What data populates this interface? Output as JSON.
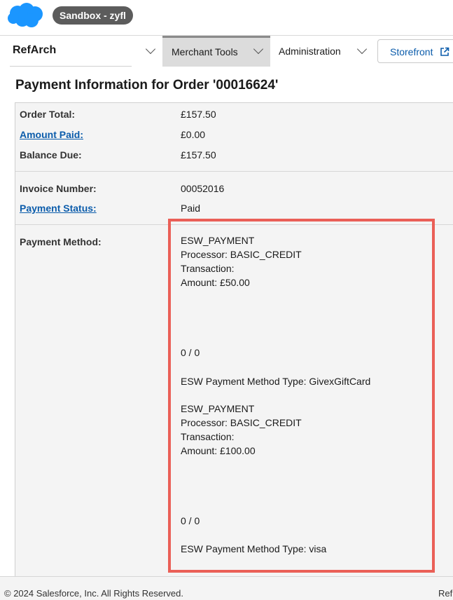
{
  "header": {
    "sandbox_label": "Sandbox - zyfl"
  },
  "nav": {
    "site": "RefArch",
    "merchant_tools": "Merchant Tools",
    "administration": "Administration",
    "storefront": "Storefront"
  },
  "page": {
    "title": "Payment Information for Order '00016624'"
  },
  "summary": {
    "order_total_label": "Order Total:",
    "order_total": "£157.50",
    "amount_paid_label": "Amount Paid:",
    "amount_paid": "£0.00",
    "balance_due_label": "Balance Due:",
    "balance_due": "£157.50",
    "invoice_number_label": "Invoice Number:",
    "invoice_number": "00052016",
    "payment_status_label": "Payment Status:",
    "payment_status": "Paid",
    "payment_method_label": "Payment Method:"
  },
  "payment_methods": [
    {
      "method": "ESW_PAYMENT",
      "processor": "Processor: BASIC_CREDIT",
      "transaction": "Transaction:",
      "amount": "Amount: £50.00",
      "ratio": "0 / 0",
      "type": "ESW Payment Method Type: GivexGiftCard"
    },
    {
      "method": "ESW_PAYMENT",
      "processor": "Processor: BASIC_CREDIT",
      "transaction": "Transaction:",
      "amount": "Amount: £100.00",
      "ratio": "0 / 0",
      "type": "ESW Payment Method Type: visa"
    }
  ],
  "footer": {
    "copyright": "© 2024 Salesforce, Inc. All Rights Reserved.",
    "right": "Ref"
  },
  "colors": {
    "highlight": "#ea5f57",
    "link": "#0b5cab",
    "brand": "#1b96ff"
  }
}
